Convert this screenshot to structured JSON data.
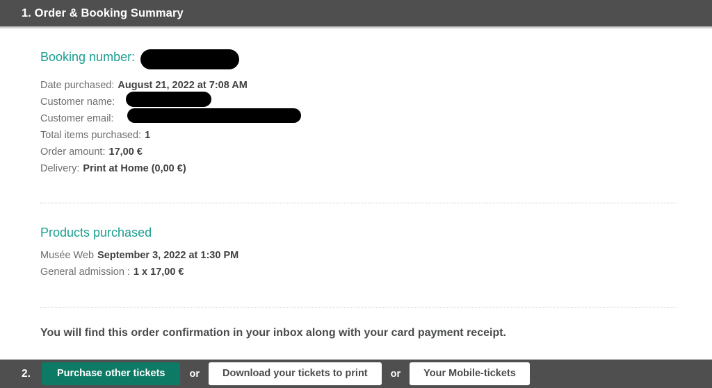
{
  "step1": {
    "header_title": "1. Order & Booking Summary",
    "booking_number_label": "Booking number:",
    "details": [
      {
        "label": "Date purchased:",
        "value": "August 21, 2022 at 7:08 AM"
      },
      {
        "label": "Customer name:",
        "value": ""
      },
      {
        "label": "Customer email:",
        "value": ""
      },
      {
        "label": "Total items purchased:",
        "value": "1"
      },
      {
        "label": "Order amount:",
        "value": "17,00 €"
      },
      {
        "label": "Delivery:",
        "value": "Print at Home (0,00 €)"
      }
    ],
    "products_title": "Products purchased",
    "products": [
      {
        "label": "Musée Web",
        "value": "September 3, 2022 at 1:30 PM"
      },
      {
        "label": "General admission :",
        "value": "1 x 17,00 €"
      }
    ],
    "confirmation_text": "You will find this order confirmation in your inbox along with your card payment receipt."
  },
  "step2": {
    "step_number": "2.",
    "primary_button": "Purchase other tickets",
    "or_label_1": "or",
    "download_button": "Download your tickets to print",
    "or_label_2": "or",
    "mobile_button": "Your Mobile-tickets"
  },
  "colors": {
    "bar_background": "#4f4f4f",
    "accent_teal": "#1a9e8f",
    "primary_button": "#0d7a65",
    "body_text": "#6d6e71",
    "value_text": "#3f4042",
    "redaction": "#000000"
  }
}
